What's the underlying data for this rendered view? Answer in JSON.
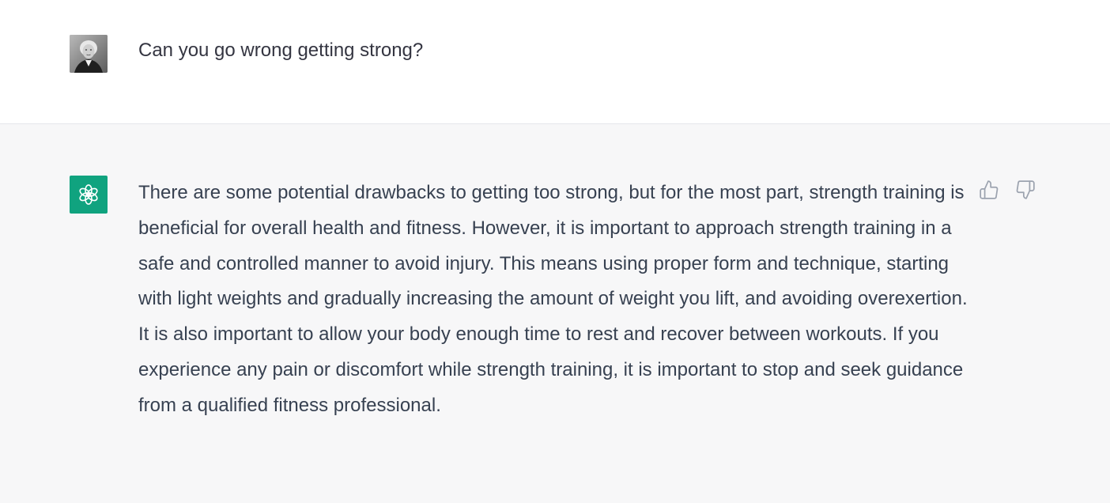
{
  "conversation": {
    "user_message": {
      "text": "Can you go wrong getting strong?",
      "avatar_icon": "user-portrait-avatar"
    },
    "assistant_message": {
      "text": "There are some potential drawbacks to getting too strong, but for the most part, strength training is beneficial for overall health and fitness. However, it is important to approach strength training in a safe and controlled manner to avoid injury. This means using proper form and technique, starting with light weights and gradually increasing the amount of weight you lift, and avoiding overexertion. It is also important to allow your body enough time to rest and recover between workouts. If you experience any pain or discomfort while strength training, it is important to stop and seek guidance from a qualified fitness professional.",
      "avatar_icon": "openai-logo-icon",
      "avatar_color": "#10a37f"
    },
    "feedback": {
      "up_icon": "thumbs-up-icon",
      "down_icon": "thumbs-down-icon"
    }
  },
  "colors": {
    "user_bg": "#ffffff",
    "assistant_bg": "#f7f7f8",
    "text": "#374151",
    "border": "#e5e7eb"
  }
}
